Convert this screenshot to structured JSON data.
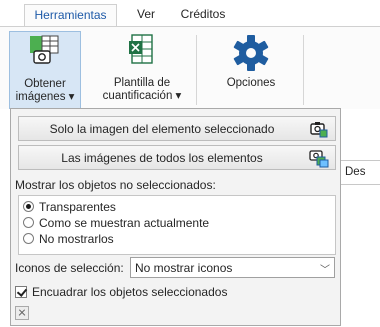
{
  "ribbon": {
    "tabs": [
      {
        "label": "Herramientas",
        "active": true
      },
      {
        "label": "Ver",
        "active": false
      },
      {
        "label": "Créditos",
        "active": false
      }
    ],
    "groups": {
      "get_images": {
        "line1": "Obtener",
        "line2": "imágenes ▾"
      },
      "template": {
        "line1": "Plantilla de",
        "line2": "cuantificación ▾"
      },
      "options": {
        "line1": "Opciones"
      }
    }
  },
  "background": {
    "column_header": "Des"
  },
  "panel": {
    "btn_selected_only": "Solo la imagen del elemento seleccionado",
    "btn_all": "Las imágenes de todos los elementos",
    "show_unselected_label": "Mostrar los objetos no seleccionados:",
    "radios": [
      {
        "label": "Transparentes",
        "checked": true
      },
      {
        "label": "Como se muestran actualmente",
        "checked": false
      },
      {
        "label": "No mostrarlos",
        "checked": false
      }
    ],
    "icons_label": "Iconos de selección:",
    "icons_value": "No mostrar iconos",
    "fit_label": "Encuadrar los objetos seleccionados",
    "fit_checked": true
  },
  "colors": {
    "accent": "#1e5aa8",
    "selected_group_bg": "#d7e6f5",
    "icon_blue": "#1f5da0",
    "excel_green": "#207245"
  }
}
